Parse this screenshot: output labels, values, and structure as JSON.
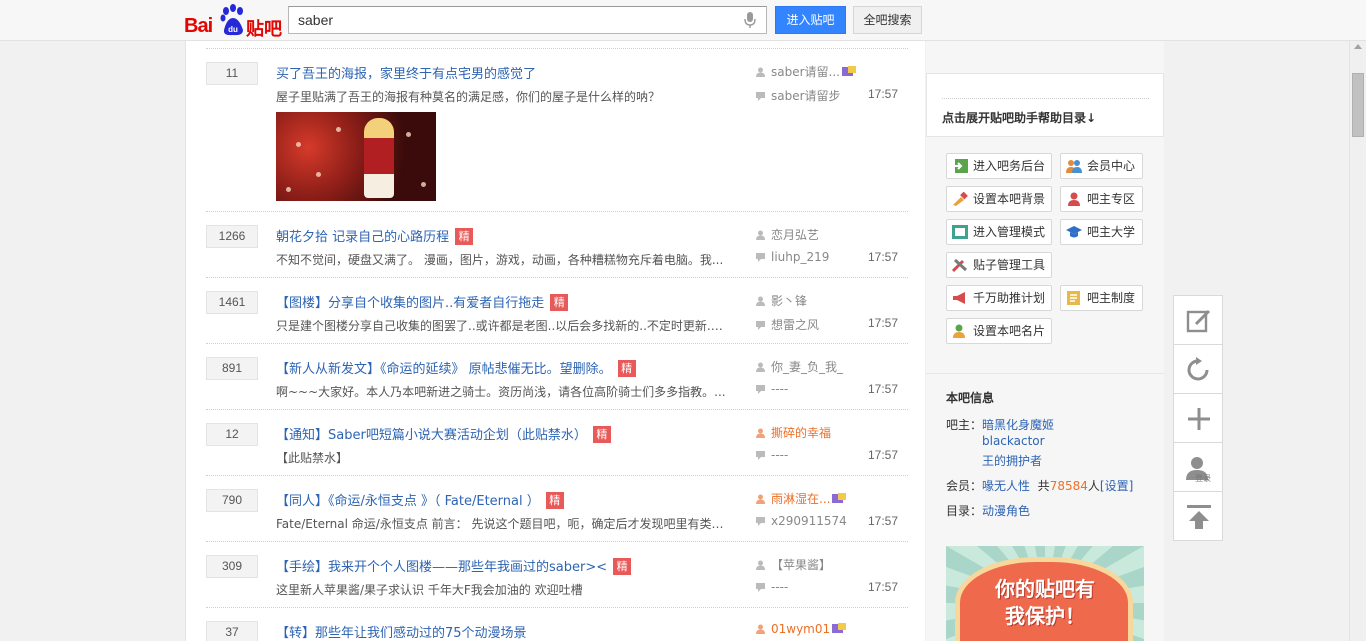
{
  "header": {
    "logo_text_bai": "Bai",
    "logo_text_du": "du",
    "logo_text_tieba": "贴吧",
    "search_value": "saber",
    "enter_button": "进入贴吧",
    "all_search_button": "全吧搜索"
  },
  "threads": [
    {
      "replies": "11",
      "title": "买了吾王的海报，家里终于有点宅男的感觉了",
      "jing": "",
      "excerpt": "屋子里贴满了吾王的海报有种莫名的满足感，你们的屋子是什么样的呐？",
      "author": "saber请留...",
      "last_reply": "saber请留步",
      "time": "17:57"
    },
    {
      "replies": "1266",
      "title": "朝花夕拾 记录自己的心路历程",
      "jing": "精",
      "excerpt": "不知不觉间，硬盘又满了。 漫画，图片，游戏，动画，各种糟糕物充斥着电脑。我...",
      "author": "恋月弘艺",
      "last_reply": "liuhp_219",
      "time": "17:57"
    },
    {
      "replies": "1461",
      "title": "【图楼】分享自个收集的图片..有爱者自行拖走",
      "jing": "精",
      "excerpt": "只是建个图楼分享自己收集的图罢了..或许都是老图..以后会多找新的..不定时更新.. ...",
      "author": "影丶锋",
      "last_reply": "想雷之风",
      "time": "17:57"
    },
    {
      "replies": "891",
      "title": "【新人从新发文】《命运的延续》 原帖悲催无比。望删除。",
      "jing": "精",
      "excerpt": "啊~~~大家好。本人乃本吧新进之骑士。资历尚浅，请各位高阶骑士们多多指教。...",
      "author": "你_妻_负_我_",
      "last_reply": "----",
      "time": "17:57"
    },
    {
      "replies": "12",
      "title": "【通知】Saber吧短篇小说大赛活动企划（此贴禁水）",
      "jing": "精",
      "excerpt": "【此贴禁水】",
      "author": "撕碎的幸福",
      "last_reply": "----",
      "time": "17:57"
    },
    {
      "replies": "790",
      "title": "【同人】《命运/永恒支点 》（ Fate/Eternal ）",
      "jing": "精",
      "excerpt": "Fate/Eternal 命运/永恒支点 前言： 先说这个题目吧，呃，确定后才发现吧里有类似...",
      "author": "雨淋湿在...",
      "last_reply": "x290911574",
      "time": "17:57"
    },
    {
      "replies": "309",
      "title": "【手绘】我来开个个人图楼——那些年我画过的saber><",
      "jing": "精",
      "excerpt": "这里新人苹果酱/果子求认识 千年大F我会加油的 欢迎吐槽",
      "author": "【苹果酱】",
      "last_reply": "----",
      "time": "17:57"
    },
    {
      "replies": "37",
      "title": "【转】那些年让我们感动过的75个动漫场景",
      "jing": "",
      "excerpt": "",
      "author": "01wym01",
      "last_reply": "",
      "time": ""
    }
  ],
  "sidebar": {
    "help_text": "点击展开贴吧助手帮助目录↓",
    "tools": [
      "进入吧务后台",
      "会员中心",
      "设置本吧背景",
      "吧主专区",
      "进入管理模式",
      "吧主大学",
      "贴子管理工具",
      "千万助推计划",
      "吧主制度",
      "设置本吧名片"
    ],
    "info_title": "本吧信息",
    "owner_label": "吧主：",
    "owners": [
      "暗黑化身魔姬",
      "blackactor",
      "王的拥护者"
    ],
    "member_label": "会员：",
    "member_name": "喙无人性",
    "member_total_prefix": "共",
    "member_count": "78584",
    "member_unit": "人",
    "member_settings": "[设置]",
    "category_label": "目录：",
    "category": "动漫角色",
    "banner_line1": "你的贴吧有",
    "banner_line2": "我保护！"
  },
  "float_toolbar": {
    "user_caption": "登录"
  },
  "colors": {
    "link": "#2d64b3",
    "jing_badge": "#e85a5a",
    "accent_blue": "#3385ff",
    "orange_name": "#ed6f26"
  }
}
